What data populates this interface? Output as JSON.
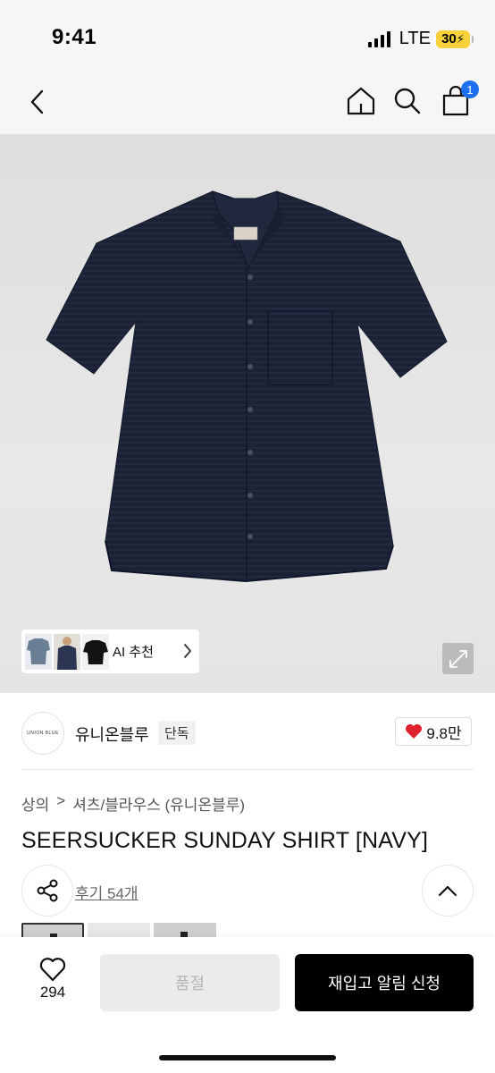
{
  "status": {
    "time": "9:41",
    "network": "LTE",
    "battery": "30"
  },
  "nav": {
    "cart_count": "1"
  },
  "colors": {
    "accent": "#1e6ff0",
    "like_heart": "#e0202e",
    "product_navy": "#1c2236"
  },
  "hero": {
    "ai_label": "AI 추천"
  },
  "brand": {
    "logo_text": "UNION BLUE",
    "name": "유니온블루",
    "tag": "단독",
    "likes": "9.8만"
  },
  "breadcrumb": {
    "level1": "상의",
    "separator": ">",
    "level2": "셔츠/블라우스 (유니온블루)"
  },
  "product": {
    "title": "SEERSUCKER SUNDAY SHIRT [NAVY]",
    "reviews": "후기 54개"
  },
  "bottom": {
    "wish_count": "294",
    "soldout_label": "품절",
    "restock_label": "재입고 알림 신청"
  }
}
